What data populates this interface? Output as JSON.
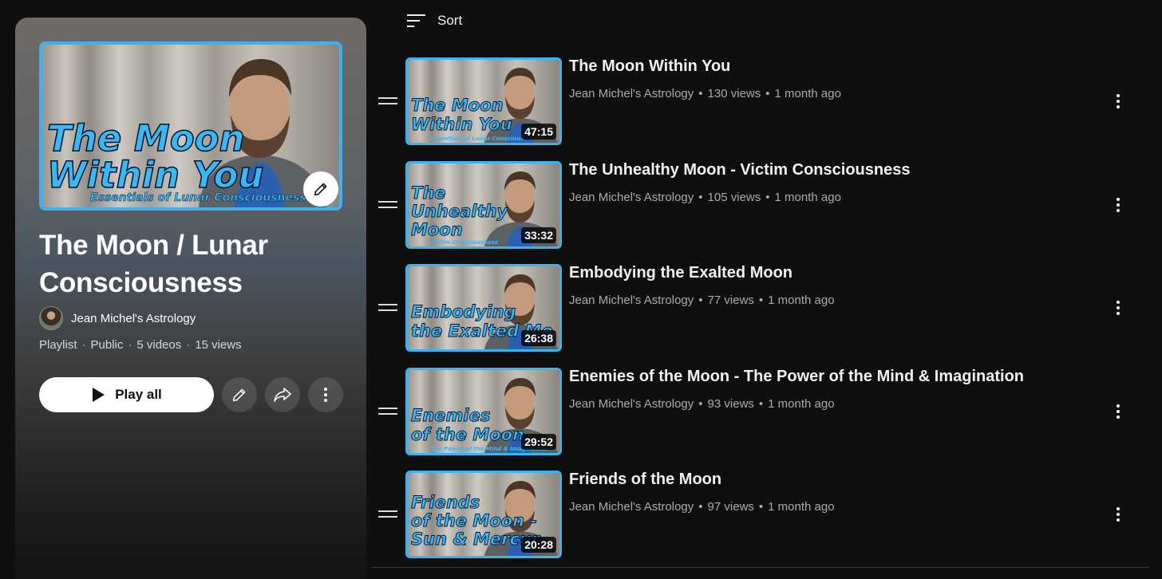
{
  "sort": {
    "label": "Sort",
    "icon": "sort-icon"
  },
  "playlist": {
    "title": "The Moon / Lunar Consciousness",
    "owner": "Jean Michel's Astrology",
    "meta": [
      "Playlist",
      "Public",
      "5 videos",
      "15 views"
    ],
    "play_all_label": "Play all",
    "hero_thumbnail": {
      "line1": "The Moon",
      "line2": "Within You",
      "subtitle": "Essentials of Lunar Consciousness"
    }
  },
  "colors": {
    "accent_border": "#3bb3f0",
    "thumb_text": "#3ab8f5",
    "background": "#0f0f0f"
  },
  "videos": [
    {
      "title": "The Moon Within You",
      "channel": "Jean Michel's Astrology",
      "views": "130 views",
      "age": "1 month ago",
      "duration": "47:15",
      "thumb_lines": [
        "The Moon",
        "Within You"
      ],
      "thumb_caption": "Essentials of Lunar Conscious"
    },
    {
      "title": "The Unhealthy Moon - Victim Consciousness",
      "channel": "Jean Michel's Astrology",
      "views": "105 views",
      "age": "1 month ago",
      "duration": "33:32",
      "thumb_lines": [
        "The",
        "Unhealthy",
        "Moon"
      ],
      "thumb_caption": "Victim Consciousness"
    },
    {
      "title": "Embodying the Exalted Moon",
      "channel": "Jean Michel's Astrology",
      "views": "77 views",
      "age": "1 month ago",
      "duration": "26:38",
      "thumb_lines": [
        "Embodying",
        "the Exalted Mo"
      ],
      "thumb_caption": ""
    },
    {
      "title": "Enemies of the Moon - The Power of the Mind & Imagination",
      "channel": "Jean Michel's Astrology",
      "views": "93 views",
      "age": "1 month ago",
      "duration": "29:52",
      "thumb_lines": [
        "Enemies",
        "of the Moon"
      ],
      "thumb_caption": "The Power of the Mind & Imagination"
    },
    {
      "title": "Friends of the Moon",
      "channel": "Jean Michel's Astrology",
      "views": "97 views",
      "age": "1 month ago",
      "duration": "20:28",
      "thumb_lines": [
        "Friends",
        "of the Moon -",
        "Sun & Mercur"
      ],
      "thumb_caption": ""
    }
  ]
}
